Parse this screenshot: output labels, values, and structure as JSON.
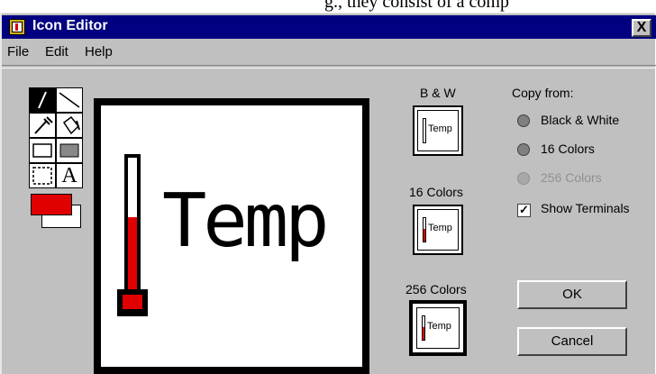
{
  "crop_text": "g., they consist of a comp",
  "window": {
    "title": "Icon Editor",
    "close_label": "X"
  },
  "menu": {
    "file": "File",
    "edit": "Edit",
    "help": "Help"
  },
  "tools": {
    "text_tool_label": "A"
  },
  "colors": {
    "foreground": "#e00000",
    "background": "#ffffff",
    "title_bar": "#000080"
  },
  "canvas": {
    "text": "Temp"
  },
  "previews": {
    "bw_label": "B & W",
    "colors16_label": "16 Colors",
    "colors256_label": "256 Colors",
    "icon_text": "Temp"
  },
  "copy_from": {
    "heading": "Copy from:",
    "option_bw": "Black & White",
    "option_16": "16 Colors",
    "option_256": "256 Colors",
    "show_terminals": "Show Terminals",
    "show_terminals_checked": true
  },
  "buttons": {
    "ok": "OK",
    "cancel": "Cancel"
  }
}
